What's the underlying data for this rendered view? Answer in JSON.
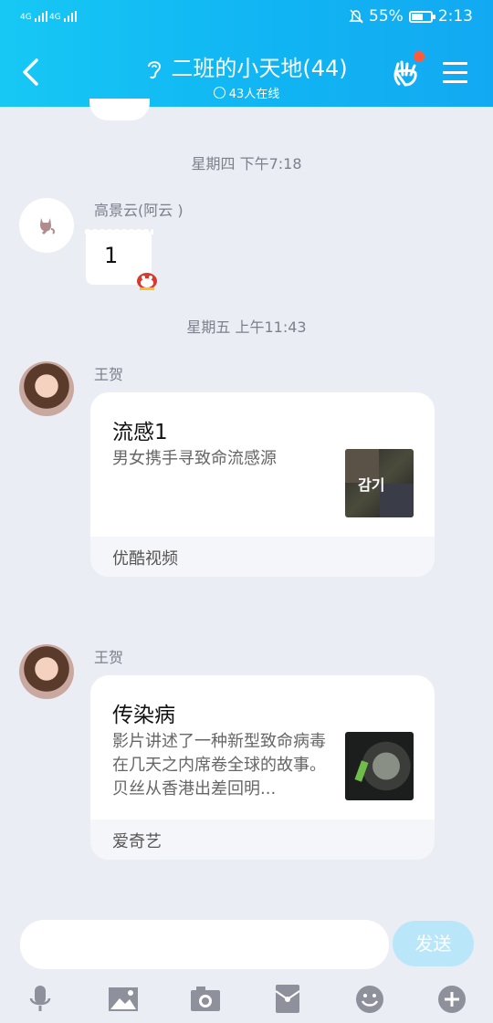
{
  "status_bar": {
    "signal1": "4G",
    "signal2": "4G",
    "battery": "55%",
    "battery_level": 0.55,
    "time": "2:13"
  },
  "header": {
    "title": "二班的小天地(44)",
    "online": "43人在线"
  },
  "messages": [
    {
      "timestamp": "星期四 下午7:18",
      "sender": "高景云(阿云 )",
      "text": "1"
    },
    {
      "timestamp": "星期五 上午11:43",
      "sender": "王贺",
      "card": {
        "title": "流感1",
        "desc": "男女携手寻致命流感源",
        "source": "优酷视频",
        "thumb_text": "감기"
      }
    },
    {
      "sender": "王贺",
      "card": {
        "title": "传染病",
        "desc": "影片讲述了一种新型致命病毒在几天之内席卷全球的故事。贝丝从香港出差回明...",
        "source": "爱奇艺"
      }
    }
  ],
  "composer": {
    "placeholder": "",
    "send_label": "发送"
  },
  "toolbar": [
    "microphone-icon",
    "image-icon",
    "camera-icon",
    "red-packet-icon",
    "emoji-icon",
    "plus-icon"
  ],
  "colors": {
    "header": "#12b4f3",
    "send_disabled": "#b9e7f9",
    "background": "#ebedf5"
  }
}
